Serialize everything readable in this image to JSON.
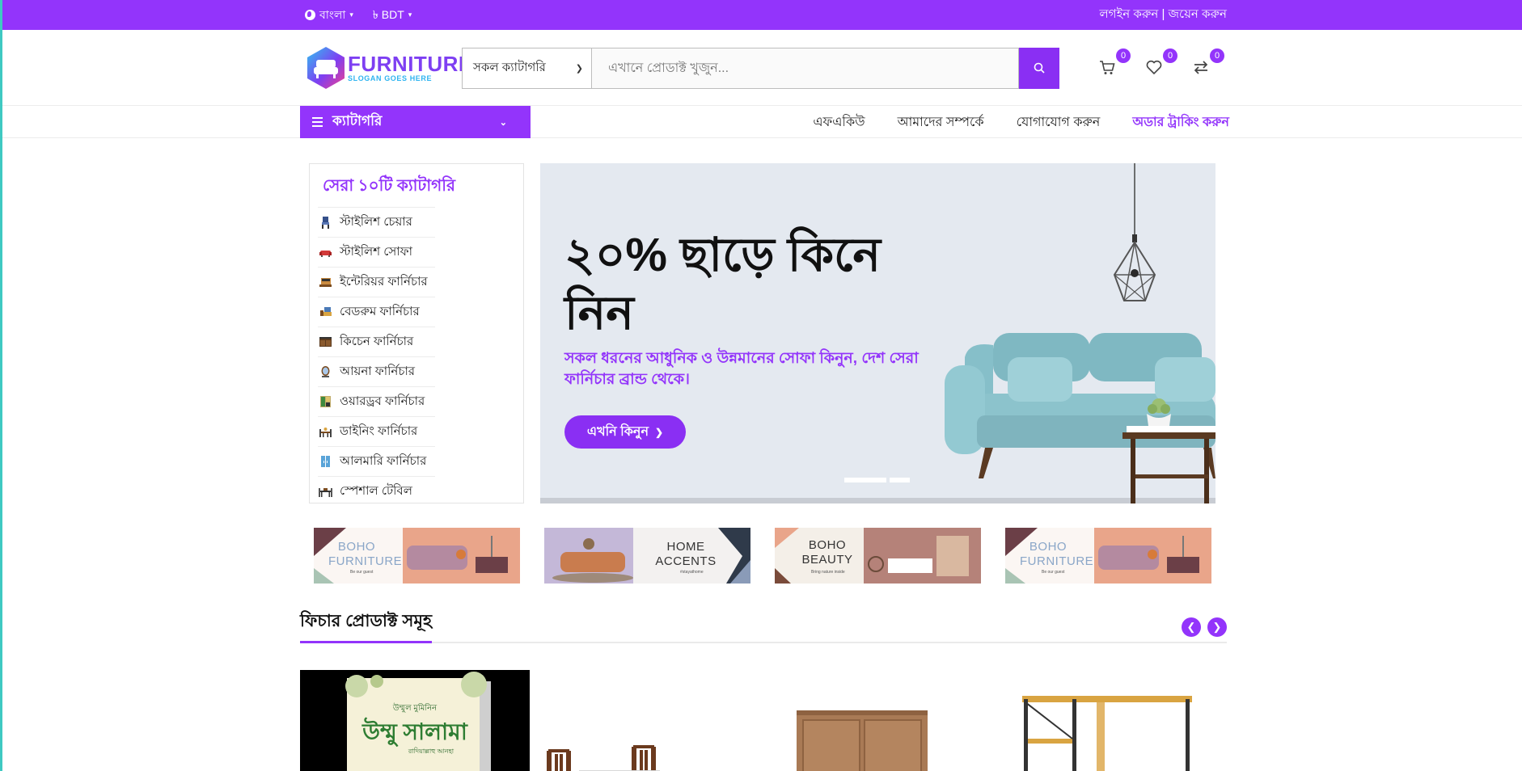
{
  "topbar": {
    "language": "বাংলা",
    "currency": "৳ BDT",
    "login": "লগইন করুন",
    "separator": "|",
    "register": "জয়েন করুন"
  },
  "logo": {
    "brand": "FURNITURE",
    "slogan": "SLOGAN GOES HERE"
  },
  "search": {
    "category_selected": "সকল ক্যাটাগরি",
    "placeholder": "এখানে প্রোডাক্ট খুজুন..."
  },
  "header_icons": {
    "cart_count": "0",
    "wishlist_count": "0",
    "compare_count": "0"
  },
  "nav": {
    "category_button": "ক্যাটাগরি",
    "links": [
      "এফএকিউ",
      "আমাদের সম্পর্কে",
      "যোগাযোগ করুন",
      "অডার ট্রাকিং করুন"
    ]
  },
  "top_categories": {
    "title": "সেরা ১০টি ক্যাটাগরি",
    "items": [
      {
        "label": "স্টাইলিশ চেয়ার",
        "icon": "chair-icon"
      },
      {
        "label": "স্টাইলিশ সোফা",
        "icon": "sofa-icon"
      },
      {
        "label": "ইন্টেরিয়র ফার্নিচার",
        "icon": "interior-icon"
      },
      {
        "label": "বেডরুম ফার্নিচার",
        "icon": "bedroom-icon"
      },
      {
        "label": "কিচেন ফার্নিচার",
        "icon": "kitchen-icon"
      },
      {
        "label": "আয়না ফার্নিচার",
        "icon": "mirror-icon"
      },
      {
        "label": "ওয়ারড্রব ফার্নিচার",
        "icon": "wardrobe-icon"
      },
      {
        "label": "ডাইনিং ফার্নিচার",
        "icon": "dining-icon"
      },
      {
        "label": "আলমারি ফার্নিচার",
        "icon": "almirah-icon"
      },
      {
        "label": "স্পেশাল টেবিল",
        "icon": "table-icon"
      }
    ]
  },
  "hero": {
    "title": "২০% ছাড়ে কিনে নিন",
    "subtitle": "সকল ধরনের আধুনিক ও উন্নমানের সোফা কিনুন, দেশ সেরা ফার্নিচার ব্রান্ড থেকে।",
    "button": "এখনি কিনুন"
  },
  "promos": [
    {
      "line1": "BOHO",
      "line2": "FURNITURE",
      "small": "Be our guest"
    },
    {
      "line1": "HOME",
      "line2": "ACCENTS",
      "small": "#stayathome"
    },
    {
      "line1": "BOHO",
      "line2": "BEAUTY",
      "small": "Bring nature inside"
    },
    {
      "line1": "BOHO",
      "line2": "FURNITURE",
      "small": "Be our guest"
    }
  ],
  "featured": {
    "title": "ফিচার প্রোডাক্ট সমূহ"
  },
  "book": {
    "top": "উম্মুল মুমিনিন",
    "title": "উম্মু সালামা",
    "sub": "রাদিয়াল্লাহু আনহা"
  },
  "colors": {
    "primary": "#9334fb",
    "hero_bg": "#e4e9f0",
    "sofa": "#8cc3cc"
  }
}
